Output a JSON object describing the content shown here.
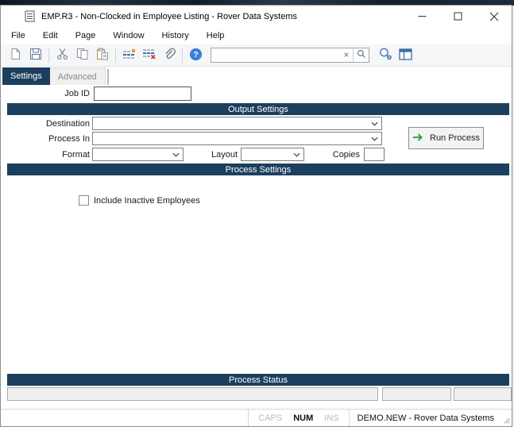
{
  "window": {
    "title": "EMP.R3 - Non-Clocked in Employee Listing - Rover Data Systems"
  },
  "menu": {
    "items": [
      "File",
      "Edit",
      "Page",
      "Window",
      "History",
      "Help"
    ]
  },
  "toolbar": {
    "icons": [
      "new-document-icon",
      "save-icon",
      "cut-icon",
      "copy-icon",
      "paste-icon",
      "insert-record-icon",
      "delete-record-icon",
      "attachment-icon",
      "help-icon",
      "clear-search-icon",
      "search-icon",
      "record-preview-icon",
      "panel-layout-icon"
    ],
    "search_value": "",
    "search_placeholder": ""
  },
  "tabs": {
    "settings": "Settings",
    "advanced": "Advanced"
  },
  "form": {
    "job_id": {
      "label": "Job ID",
      "value": ""
    },
    "output_settings": {
      "title": "Output Settings",
      "destination_label": "Destination",
      "destination_value": "",
      "process_in_label": "Process In",
      "process_in_value": "",
      "format_label": "Format",
      "format_value": "",
      "layout_label": "Layout",
      "layout_value": "",
      "copies_label": "Copies",
      "copies_value": "",
      "run_button_label": "Run Process"
    },
    "process_settings": {
      "title": "Process Settings",
      "include_inactive": {
        "label": "Include Inactive Employees",
        "checked": false
      }
    },
    "process_status": {
      "title": "Process Status",
      "fields": [
        "",
        "",
        ""
      ]
    }
  },
  "status_bar": {
    "caps": "CAPS",
    "num": "NUM",
    "ins": "INS",
    "context": "DEMO.NEW - Rover Data Systems"
  },
  "colors": {
    "section_header": "#1d3f5f",
    "active_tab": "#1d3f5f",
    "help_blue": "#3d7edb",
    "icon_blue": "#3b6ea5",
    "run_arrow_green": "#17a23b",
    "insert_orange": "#e8983a",
    "delete_red": "#c0392b"
  }
}
